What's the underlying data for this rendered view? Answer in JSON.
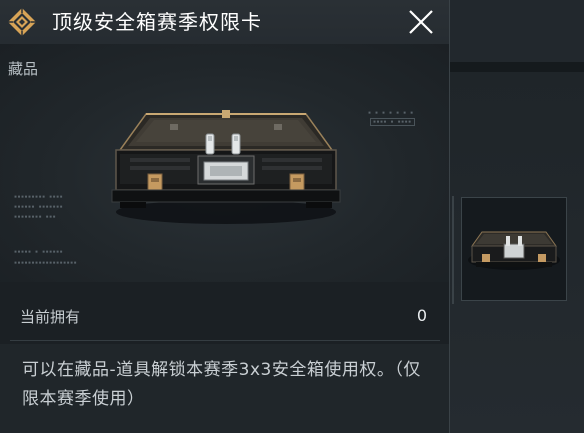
{
  "header": {
    "title": "顶级安全箱赛季权限卡"
  },
  "showcase": {
    "category": "藏品"
  },
  "ownership": {
    "label": "当前拥有",
    "value": "0"
  },
  "description": "可以在藏品-道具解锁本赛季3x3安全箱使用权。（仅限本赛季使用）",
  "colors": {
    "logo_gold": "#d8a457",
    "panel_bg": "#20262a",
    "text_primary": "#ffffff"
  },
  "icons": {
    "logo": "diamond-emblem-icon",
    "close": "close-icon"
  }
}
